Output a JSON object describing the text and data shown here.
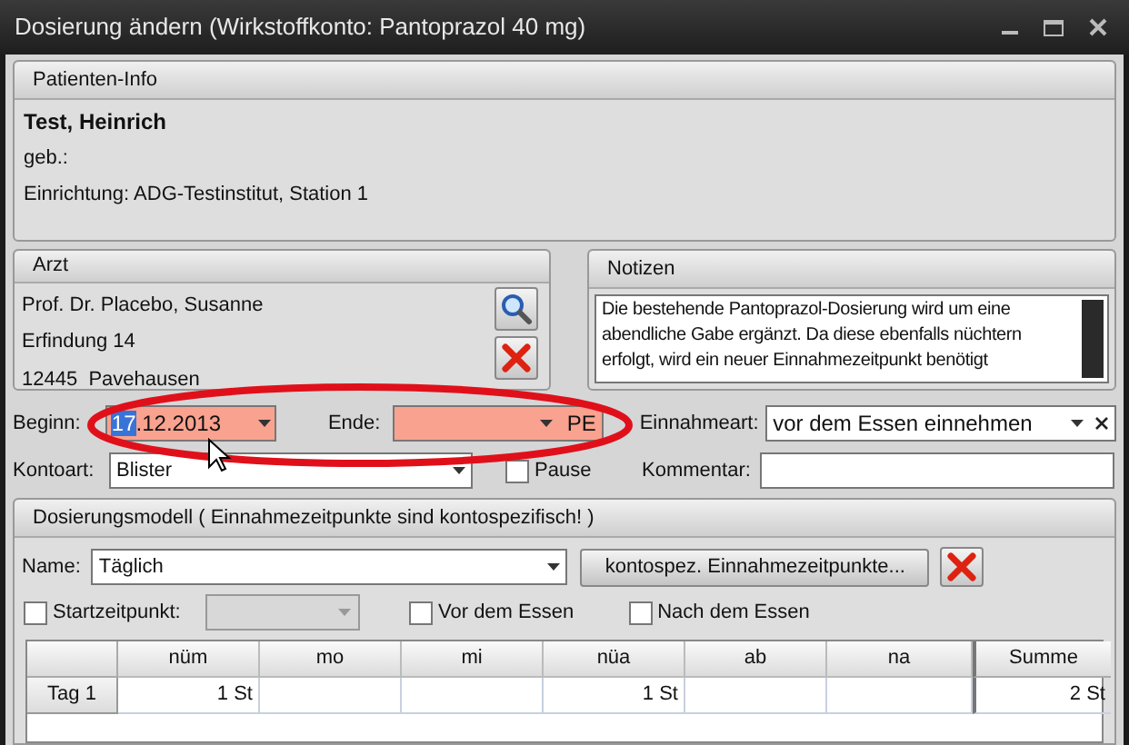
{
  "window": {
    "title": "Dosierung ändern (Wirkstoffkonto: Pantoprazol 40 mg)"
  },
  "patient": {
    "header": "Patienten-Info",
    "name": "Test, Heinrich",
    "birth": "geb.:",
    "facility": "Einrichtung: ADG-Testinstitut, Station 1"
  },
  "doctor": {
    "header": "Arzt",
    "lines": [
      "Prof. Dr. Placebo, Susanne",
      "Erfindung 14",
      "12445  Pavehausen"
    ]
  },
  "notes": {
    "header": "Notizen",
    "text": "Die bestehende Pantoprazol-Dosierung wird um eine abendliche Gabe ergänzt. Da diese ebenfalls nüchtern erfolgt, wird ein neuer Einnahmezeitpunkt benötigt"
  },
  "begin": {
    "label": "Beginn:",
    "value_selected": "17",
    "value_rest": ".12.2013",
    "invalid": true
  },
  "end": {
    "label": "Ende:",
    "suffix": "PE",
    "invalid": true
  },
  "intake_type": {
    "label": "Einnahmeart:",
    "value": "vor dem Essen einnehmen"
  },
  "account_type": {
    "label": "Kontoart:",
    "value": "Blister"
  },
  "pause": {
    "label": "Pause",
    "checked": false
  },
  "comment": {
    "label": "Kommentar:"
  },
  "dosing_model": {
    "header": "Dosierungsmodell  ( Einnahmezeitpunkte sind kontospezifisch! )",
    "name_label": "Name:",
    "name_value": "Täglich",
    "button": "kontospez. Einnahmezeitpunkte...",
    "start": {
      "label": "Startzeitpunkt:",
      "checked": false
    },
    "checkboxes": [
      {
        "label": "Vor dem Essen",
        "checked": false
      },
      {
        "label": "Nach dem Essen",
        "checked": false
      }
    ],
    "columns": [
      "nüm",
      "mo",
      "mi",
      "nüa",
      "ab",
      "na",
      "Summe"
    ],
    "rows": [
      {
        "label": "Tag 1",
        "cells": [
          "1 St",
          "",
          "",
          "1 St",
          "",
          "",
          "2 St"
        ]
      }
    ]
  }
}
